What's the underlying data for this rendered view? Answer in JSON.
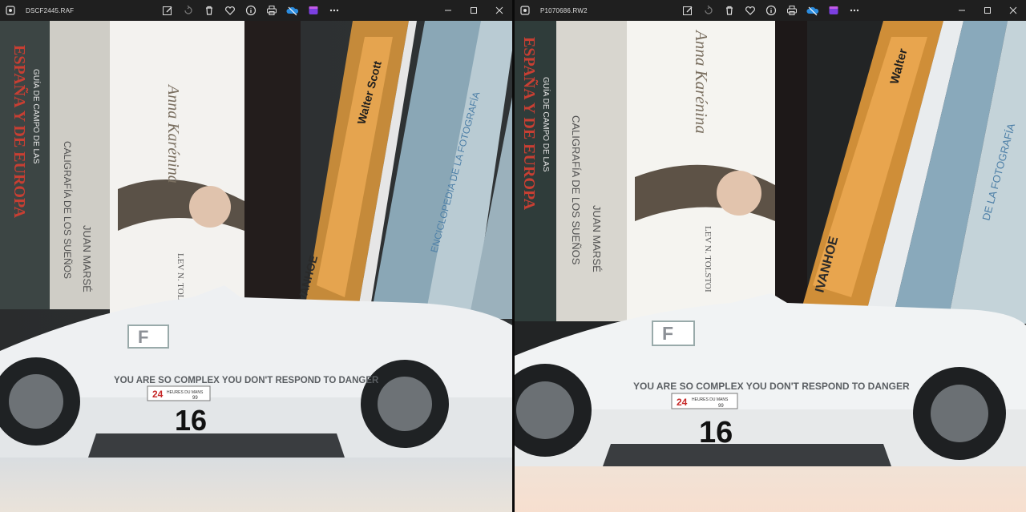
{
  "windows": [
    {
      "filename": "DSCF2445.RAF",
      "photo": {
        "book_titles": {
          "spain": "ESPAÑA Y DE EUROPA",
          "guide": "GUÍA DE CAMPO DE LAS",
          "dreams_title": "CALIGRAFÍA DE LOS SUEÑOS",
          "dreams_author": "JUAN MARSÉ",
          "karenina_title": "Anna Karénina",
          "karenina_author": "LEV N. TOLSTOI",
          "scott": "Walter Scott",
          "ivanhoe": "IVANHOE",
          "photo_encyclopedia": "ENCICLOPEDIA DE LA FOTOGRAFÍA"
        },
        "car": {
          "slogan": "YOU ARE SO COMPLEX YOU DON'T RESPOND TO DANGER",
          "race_number": "16",
          "badge_main": "24",
          "badge_text": "HEURES DU MANS",
          "badge_year": "99",
          "logo_letter": "F"
        }
      }
    },
    {
      "filename": "P1070686.RW2",
      "photo": {
        "book_titles": {
          "spain": "ESPAÑA Y DE EUROPA",
          "guide": "GUÍA DE CAMPO DE LAS",
          "dreams_title": "CALIGRAFÍA DE LOS SUEÑOS",
          "dreams_author": "JUAN MARSÉ",
          "karenina_title": "Anna Karénina",
          "karenina_author": "LEV N. TOLSTOI",
          "scott": "Walter",
          "ivanhoe": "IVANHOE",
          "photo_encyclopedia": "DE LA FOTOGRAFÍA"
        },
        "car": {
          "slogan": "YOU ARE SO COMPLEX YOU DON'T RESPOND TO DANGER",
          "race_number": "16",
          "badge_main": "24",
          "badge_text": "HEURES DU MANS",
          "badge_year": "99",
          "logo_letter": "F"
        }
      }
    }
  ],
  "icons": [
    "photos-app-icon",
    "edit-icon",
    "rotate-icon",
    "delete-icon",
    "favorite-icon",
    "info-icon",
    "print-icon",
    "onedrive-icon",
    "clipchamp-icon",
    "more-icon",
    "minimize-icon",
    "maximize-icon",
    "close-icon"
  ],
  "colors": {
    "titlebar": "#1f1f1f",
    "text": "#e8e8e8"
  }
}
